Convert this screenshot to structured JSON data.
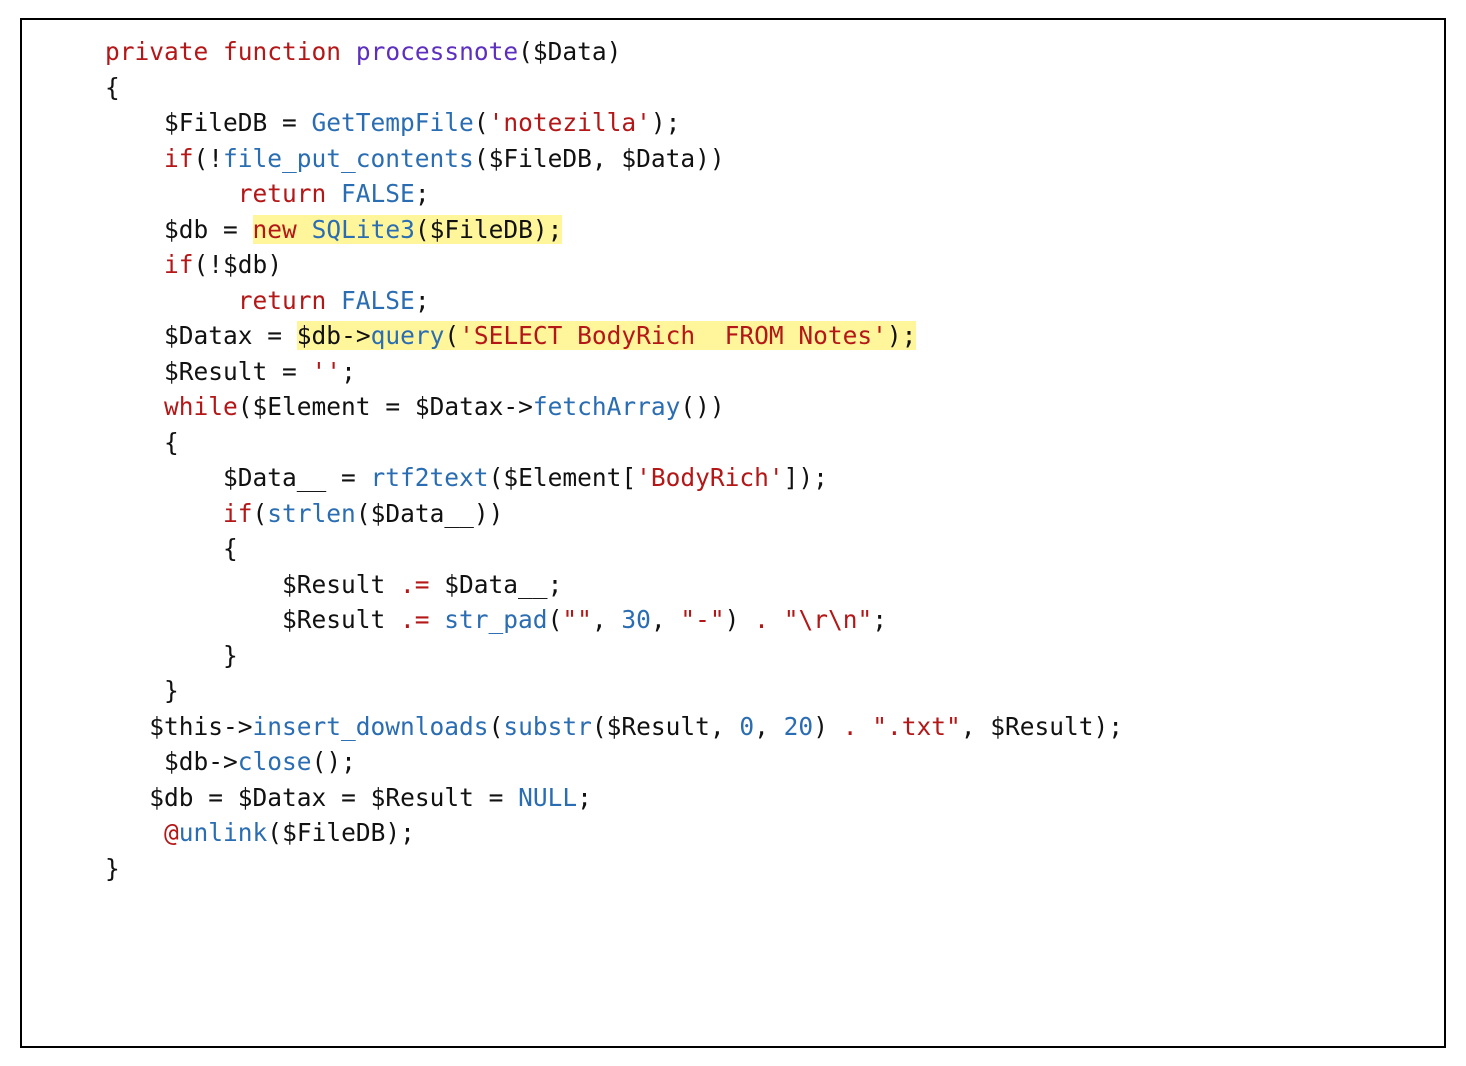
{
  "code": {
    "l1": {
      "kw_private": "private",
      "kw_function": "function",
      "fname": "processnote",
      "p_open": "(",
      "var_data": "$Data",
      "p_close": ")"
    },
    "l2": {
      "brace": "{"
    },
    "l3": {
      "var_filedb": "$FileDB",
      "eq": " = ",
      "fn_gettemp": "GetTempFile",
      "p_open": "(",
      "str": "'notezilla'",
      "p_close_semi": ");"
    },
    "l4": {
      "kw_if": "if",
      "p_open": "(!",
      "fn_fpc": "file_put_contents",
      "p2_open": "(",
      "var_filedb": "$FileDB",
      "comma": ", ",
      "var_data": "$Data",
      "p_close": "))"
    },
    "l5": {
      "kw_return": "return",
      "sp": " ",
      "const_false": "FALSE",
      "semi": ";"
    },
    "l6": {
      "var_db": "$db",
      "eq": " = ",
      "kw_new": "new",
      "sp": " ",
      "cls": "SQLite3",
      "p": "($FileDB);"
    },
    "l7": {
      "kw_if": "if",
      "p": "(!",
      "var_db": "$db",
      "p_close": ")"
    },
    "l8": {
      "kw_return": "return",
      "sp": " ",
      "const_false": "FALSE",
      "semi": ";"
    },
    "l9": {
      "var_datax": "$Datax",
      "eq": " = ",
      "var_db": "$db",
      "arrow": "->",
      "fn_query": "query",
      "p_open": "(",
      "str": "'SELECT BodyRich  FROM Notes'",
      "p_close": ");"
    },
    "l10": {
      "var_result": "$Result",
      "eq": " = ",
      "str": "''",
      "semi": ";"
    },
    "l11": {
      "kw_while": "while",
      "p_open": "(",
      "var_element": "$Element",
      "eq": " = ",
      "var_datax": "$Datax",
      "arrow": "->",
      "fn_fetch": "fetchArray",
      "p_close": "())"
    },
    "l12": {
      "brace": "{"
    },
    "l13": {
      "var_data2": "$Data__",
      "eq": " = ",
      "fn_rtf": "rtf2text",
      "p_open": "(",
      "var_element": "$Element",
      "idx_open": "[",
      "str": "'BodyRich'",
      "idx_close": "]);"
    },
    "l14": {
      "kw_if": "if",
      "p_open": "(",
      "fn_strlen": "strlen",
      "p2_open": "(",
      "var_data2": "$Data__",
      "p_close": "))"
    },
    "l15": {
      "brace": "{"
    },
    "l16": {
      "var_result": "$Result",
      "dot": " .= ",
      "var_data2": "$Data__",
      "semi": ";"
    },
    "l17": {
      "var_result": "$Result",
      "dot": " .= ",
      "fn_strpad": "str_pad",
      "p_open": "(",
      "str_empty": "\"\"",
      "comma1": ", ",
      "num": "30",
      "comma2": ", ",
      "str_dash": "\"-\"",
      "p_close": ")",
      "concat": " . ",
      "str_crlf": "\"\\r\\n\"",
      "semi": ";"
    },
    "l18": {
      "brace": "}"
    },
    "l19": {
      "brace": "}"
    },
    "l20": {
      "var_this": "$this",
      "arrow": "->",
      "fn_ins": "insert_downloads",
      "p_open": "(",
      "fn_substr": "substr",
      "p2_open": "(",
      "var_result": "$Result",
      "comma1": ", ",
      "num0": "0",
      "comma2": ", ",
      "num20": "20",
      "p2_close": ")",
      "concat": " . ",
      "str_txt": "\".txt\"",
      "comma3": ", ",
      "var_result2": "$Result",
      "p_close": ");"
    },
    "l21": {
      "var_db": "$db",
      "arrow": "->",
      "fn_close": "close",
      "p": "();"
    },
    "l22": {
      "var_db": "$db",
      "eq1": " = ",
      "var_datax": "$Datax",
      "eq2": " = ",
      "var_result": "$Result",
      "eq3": " = ",
      "const_null": "NULL",
      "semi": ";"
    },
    "l23": {
      "at": "@",
      "fn_unlink": "unlink",
      "p_open": "(",
      "var_filedb": "$FileDB",
      "p_close": ");"
    },
    "l24": {
      "brace": "}"
    }
  }
}
